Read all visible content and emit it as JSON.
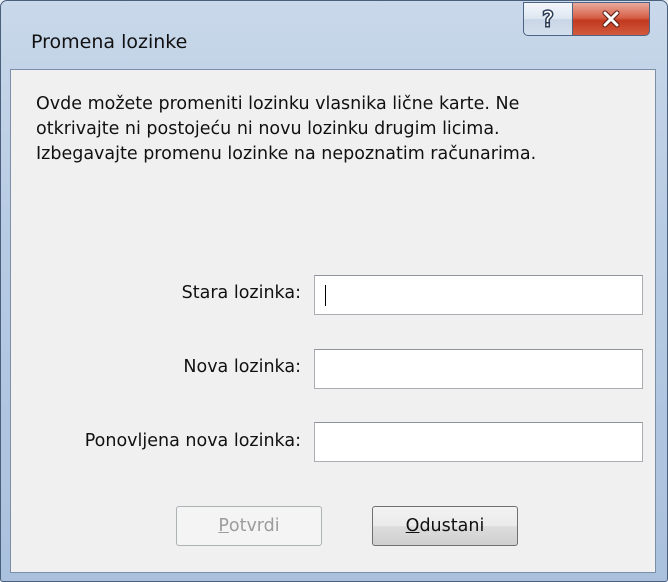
{
  "window": {
    "title": "Promena lozinke"
  },
  "titlebar_buttons": {
    "help_icon": "help-icon",
    "help_glyph": "?",
    "close_icon": "close-icon",
    "close_glyph": "x"
  },
  "description": {
    "lines": [
      "Ovde možete promeniti lozinku vlasnika lične karte. Ne",
      "otkrivajte ni postojeću ni novu lozinku drugim licima.",
      "Izbegavajte promenu lozinke na nepoznatim računarima."
    ]
  },
  "form": {
    "old_password_label": "Stara lozinka:",
    "old_password_value": "",
    "new_password_label": "Nova lozinka:",
    "new_password_value": "",
    "repeat_password_label": "Ponovljena nova lozinka:",
    "repeat_password_value": ""
  },
  "buttons": {
    "confirm_mnemonic": "P",
    "confirm_rest": "otvrdi",
    "confirm_enabled": false,
    "cancel_mnemonic": "O",
    "cancel_rest": "dustani"
  },
  "colors": {
    "close_button": "#c94a2e",
    "disabled_text": "#9c9c9c"
  }
}
